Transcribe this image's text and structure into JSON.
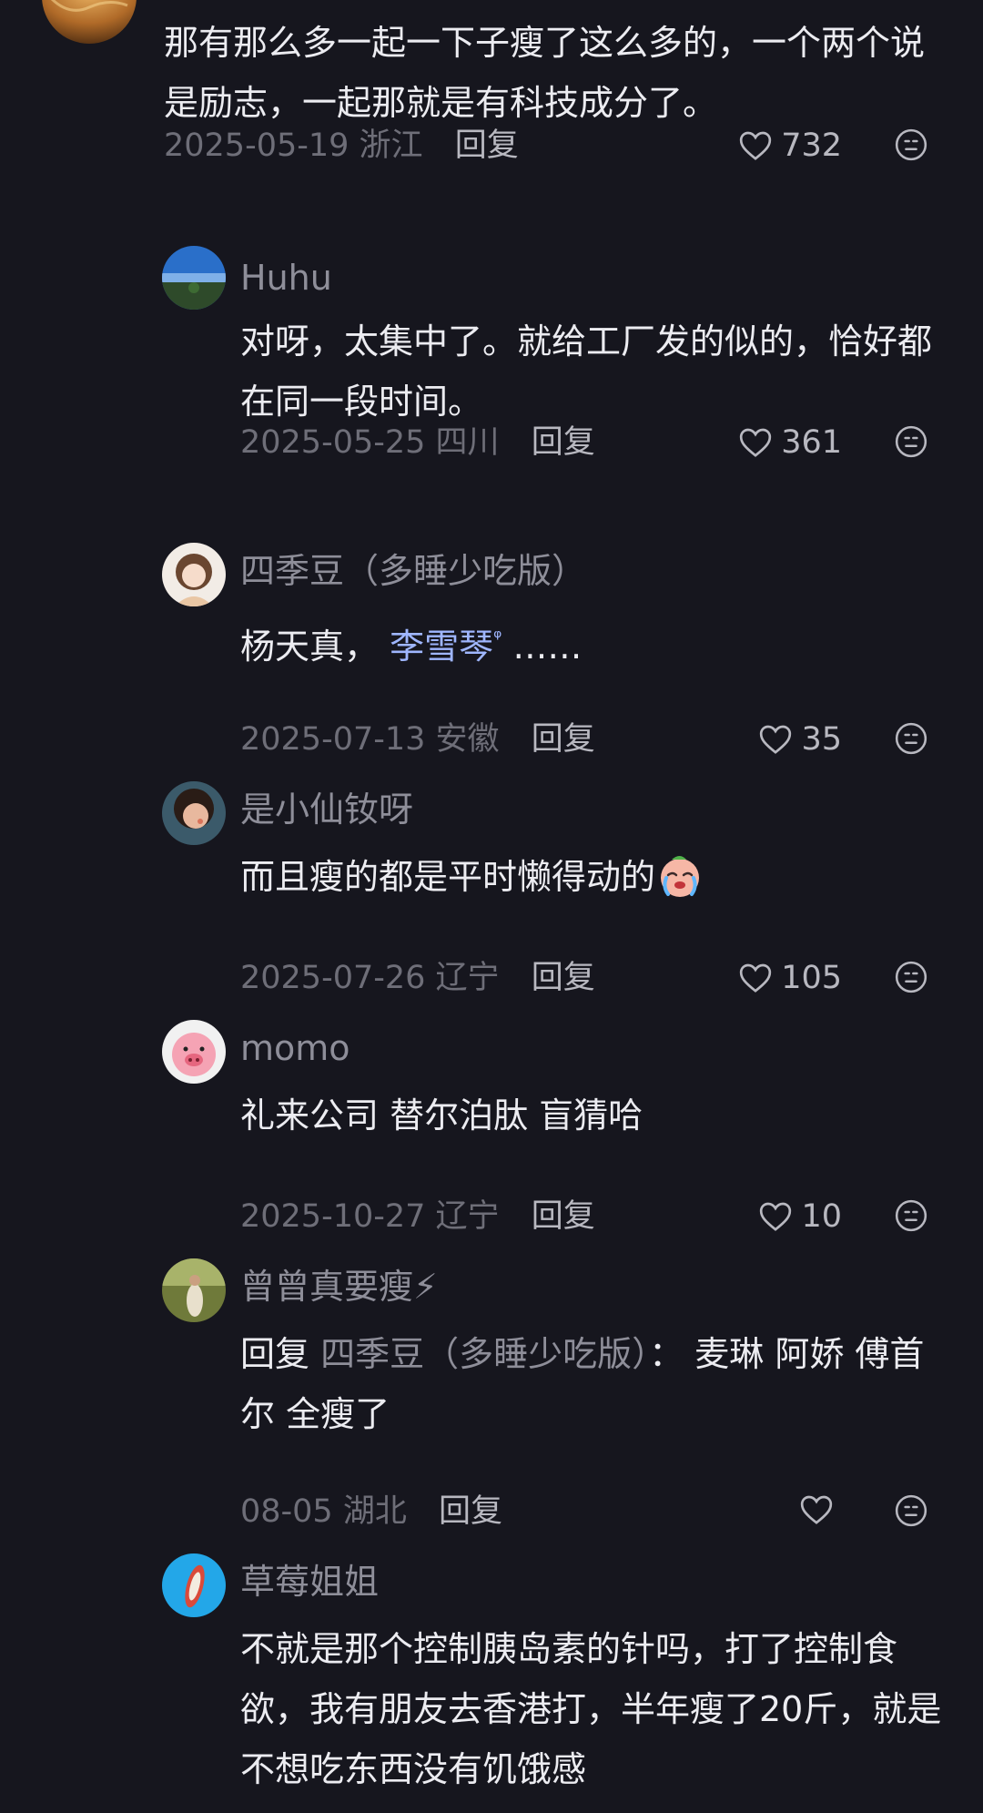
{
  "comments": [
    {
      "username": "",
      "text": "那有那么多一起一下子瘦了这么多的，一个两个说是励志，一起那就是有科技成分了。",
      "date": "2025-05-19",
      "location": "浙江",
      "reply_label": "回复",
      "likes": "732"
    },
    {
      "username": "Huhu",
      "text": "对呀，太集中了。就给工厂发的似的，恰好都在同一段时间。",
      "date": "2025-05-25",
      "location": "四川",
      "reply_label": "回复",
      "likes": "361"
    },
    {
      "username": "四季豆（多睡少吃版）",
      "text_before": "杨天真，",
      "link_text": "李雪琴",
      "text_after": "……",
      "date": "2025-07-13",
      "location": "安徽",
      "reply_label": "回复",
      "likes": "35"
    },
    {
      "username": "是小仙钕呀",
      "text": "而且瘦的都是平时懒得动的",
      "emoji": "crying-face-emoji",
      "date": "2025-07-26",
      "location": "辽宁",
      "reply_label": "回复",
      "likes": "105"
    },
    {
      "username": "momo",
      "text": "礼来公司 替尔泊肽 盲猜哈",
      "date": "2025-10-27",
      "location": "辽宁",
      "reply_label": "回复",
      "likes": "10"
    },
    {
      "username": "曾曾真要瘦⚡",
      "reply_prefix": "回复",
      "reply_target": "四季豆（多睡少吃版）",
      "reply_colon": "：",
      "text": "麦琳 阿娇 傅首尔 全瘦了",
      "date": "08-05",
      "location": "湖北",
      "reply_label": "回复",
      "likes": ""
    },
    {
      "username": "草莓姐姐",
      "text": "不就是那个控制胰岛素的针吗，打了控制食欲，我有朋友去香港打，半年瘦了20斤，就是不想吃东西没有饥饿感",
      "date": "",
      "location": "",
      "reply_label": "",
      "likes": ""
    }
  ],
  "icons": {
    "like": "heart-outline-icon",
    "dislike": "neutral-face-icon"
  },
  "colors": {
    "background": "#16161e",
    "text_primary": "#ececf1",
    "text_secondary": "#8e8e99",
    "link": "#9fb6ff"
  }
}
